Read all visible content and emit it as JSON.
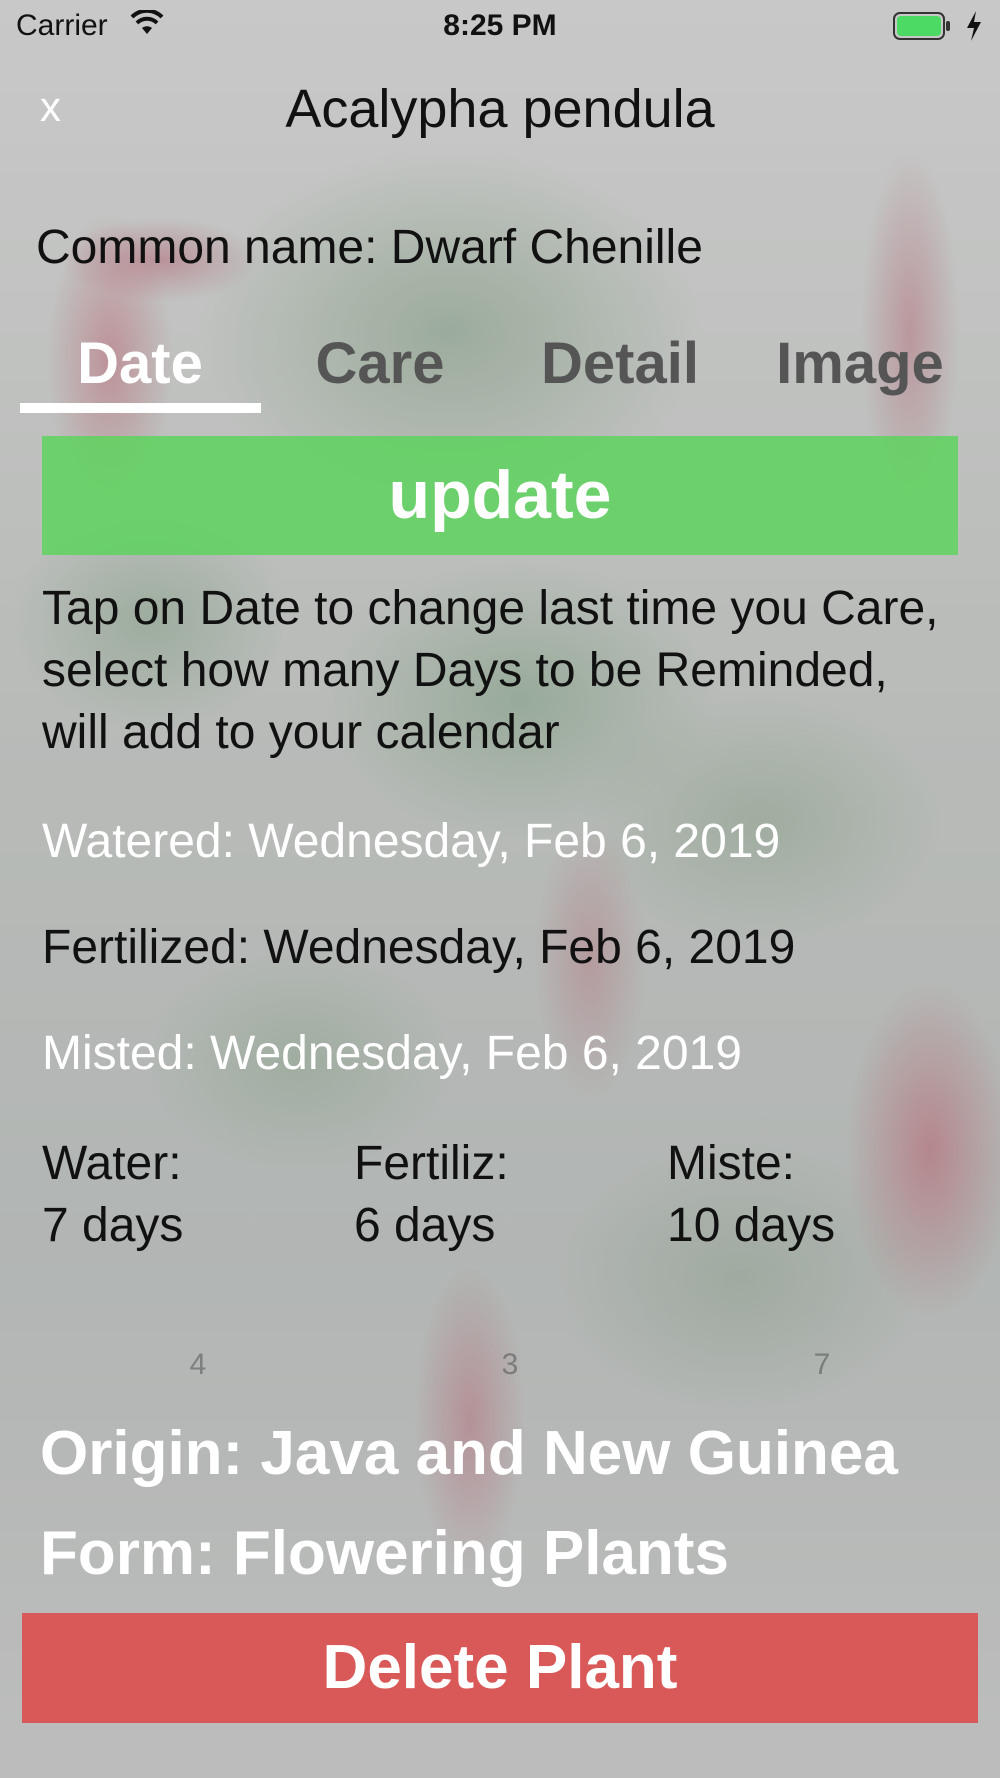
{
  "status_bar": {
    "carrier": "Carrier",
    "time": "8:25 PM",
    "battery_color": "#4cd964"
  },
  "header": {
    "close_label": "x",
    "title": "Acalypha pendula",
    "common_name": "Common name: Dwarf Chenille"
  },
  "tabs": [
    {
      "label": "Date",
      "active": true
    },
    {
      "label": "Care",
      "active": false
    },
    {
      "label": "Detail",
      "active": false
    },
    {
      "label": "Image",
      "active": false
    }
  ],
  "update_button": {
    "label": "update",
    "color": "#5ad45a"
  },
  "instructions": "Tap on Date to change last time you Care, select how many Days to be Reminded, will add to your calendar",
  "care_dates": {
    "watered": "Watered: Wednesday, Feb 6, 2019",
    "fertilized": "Fertilized: Wednesday, Feb 6, 2019",
    "misted": "Misted: Wednesday, Feb 6, 2019"
  },
  "intervals": [
    {
      "label": "Water:",
      "value": "7 days"
    },
    {
      "label": "Fertiliz:",
      "value": "6 days"
    },
    {
      "label": "Miste:",
      "value": "10 days"
    }
  ],
  "picker_hints": [
    "4",
    "3",
    "7"
  ],
  "details": {
    "origin": "Origin: Java and New Guinea",
    "form": "Form: Flowering Plants"
  },
  "delete_button": {
    "label": "Delete Plant",
    "color": "#de4848"
  }
}
